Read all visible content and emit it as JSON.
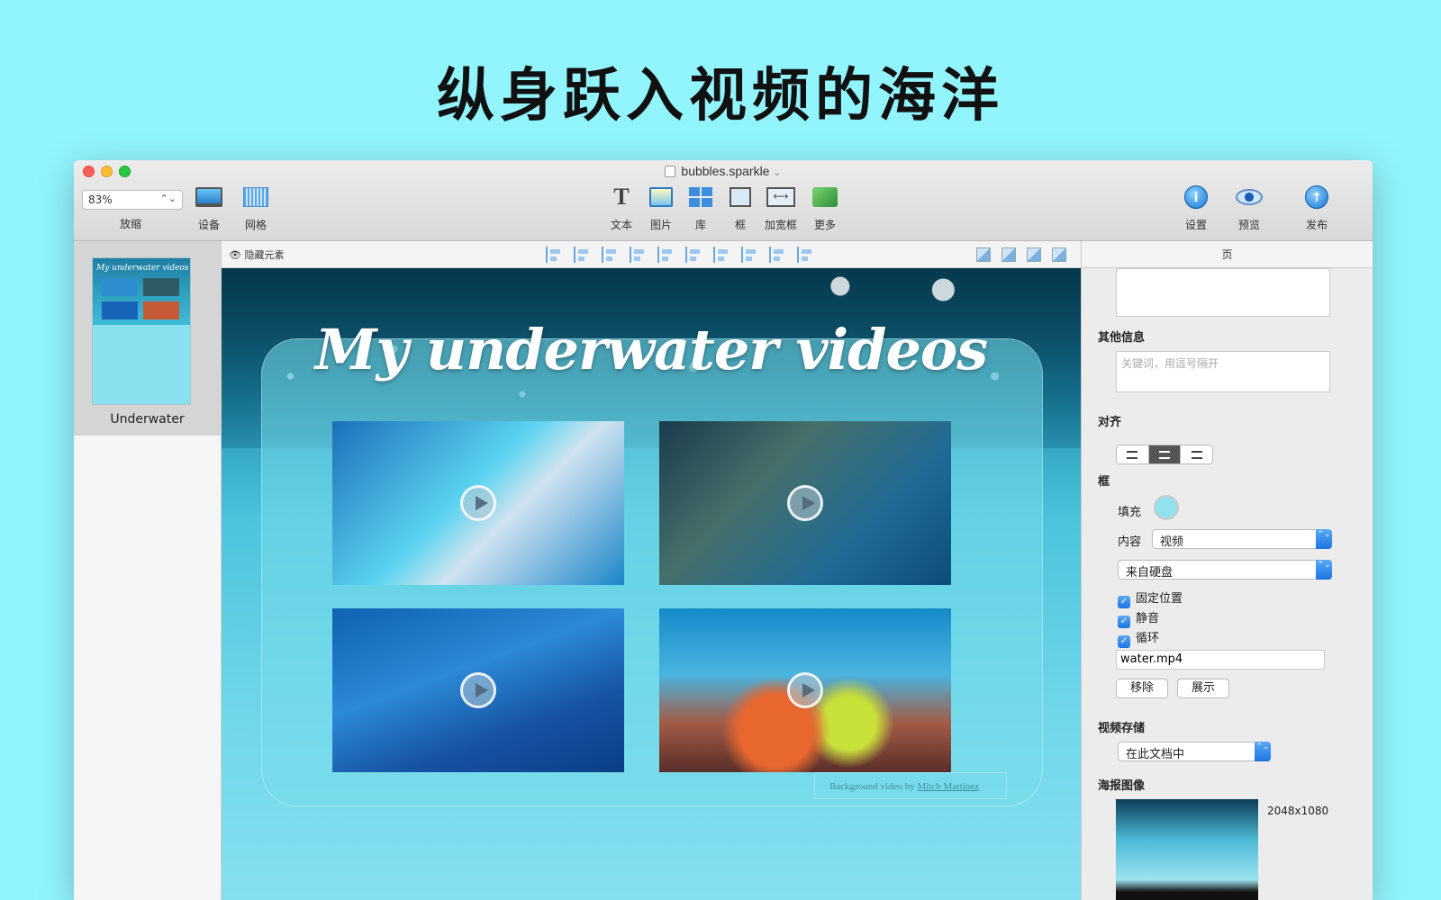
{
  "hero": {
    "title": "纵身跃入视频的海洋"
  },
  "window": {
    "title": "bubbles.sparkle",
    "title_chevron": "⌄",
    "zoom_value": "83%",
    "zoom_arrow": "⌃⌄"
  },
  "toolbar": {
    "left": [
      {
        "label": "放缩"
      },
      {
        "label": "设备"
      },
      {
        "label": "网格"
      }
    ],
    "center": {
      "text": "文本",
      "text_glyph": "T",
      "image": "图片",
      "library": "库",
      "frame": "框",
      "widen": "加宽框",
      "widen_glyph": "⟷",
      "more": "更多"
    },
    "right": {
      "settings": "设置",
      "settings_glyph": "i",
      "preview": "预览",
      "publish": "发布",
      "publish_glyph": "↑"
    }
  },
  "sidebar": {
    "page_name": "Underwater",
    "thumb_title": "My underwater videos"
  },
  "canvas_toolbar": {
    "hide_elements": "隐藏元素",
    "hide_icon": "👁"
  },
  "canvas": {
    "title": "My underwater videos",
    "credit_prefix": "Background video by ",
    "credit_link": "Mitch Martinez"
  },
  "inspector": {
    "tab": "页",
    "other_info": "其他信息",
    "keywords_placeholder": "关键词，用逗号隔开",
    "align": "对齐",
    "frame_section": "框",
    "fill_label": "填充",
    "content_label": "内容",
    "content_value": "视频",
    "source_value": "来自硬盘",
    "stepper_glyph": "⌃⌄",
    "checks": {
      "fixed": "固定位置",
      "mute": "静音",
      "loop": "循环"
    },
    "check_glyph": "✓",
    "file_name": "water.mp4",
    "remove": "移除",
    "show": "展示",
    "video_storage": "视频存储",
    "storage_value": "在此文档中",
    "poster_image": "海报图像",
    "poster_size": "2048x1080"
  }
}
